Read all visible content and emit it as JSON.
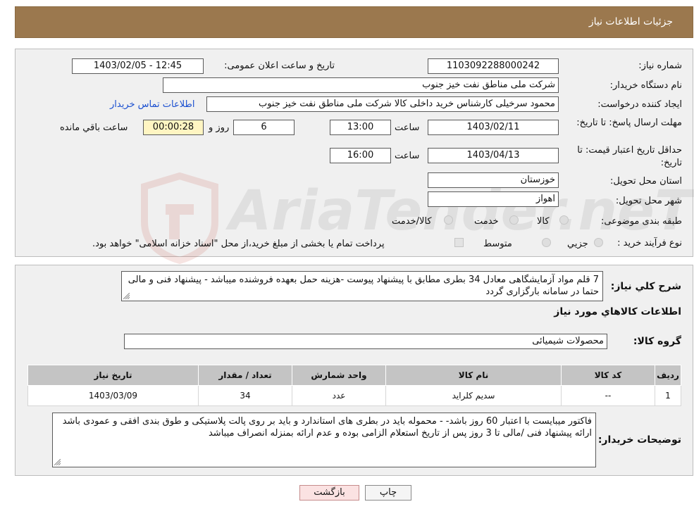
{
  "header": {
    "title": "جزئیات اطلاعات نیاز"
  },
  "form": {
    "need_number_label": "شماره نیاز:",
    "need_number": "1103092288000242",
    "announce_label": "تاریخ و ساعت اعلان عمومی:",
    "announce_value": "1403/02/05 - 12:45",
    "buyer_org_label": "نام دستگاه خریدار:",
    "buyer_org": "شرکت ملی مناطق نفت خیز جنوب",
    "creator_label": "ایجاد کننده درخواست:",
    "creator": "محمود سرخیلی کارشناس خرید داخلی کالا شرکت ملی مناطق نفت خیز جنوب",
    "contact_link": "اطلاعات تماس خریدار",
    "deadline_label": "مهلت ارسال پاسخ: تا تاریخ:",
    "deadline_date": "1403/02/11",
    "time_label": "ساعت",
    "deadline_time": "13:00",
    "days_value": "6",
    "days_label": "روز و",
    "remaining_time": "00:00:28",
    "remaining_label": "ساعت باقي مانده",
    "validity_label": "حداقل تاریخ اعتبار قیمت: تا تاریخ:",
    "validity_date": "1403/04/13",
    "validity_time": "16:00",
    "province_label": "استان محل تحویل:",
    "province": "خوزستان",
    "city_label": "شهر محل تحویل:",
    "city": "اهواز",
    "category_label": "طبقه بندی موضوعی:",
    "category_options": [
      "کالا",
      "خدمت",
      "کالا/خدمت"
    ],
    "process_label": "نوع فرآیند خرید :",
    "process_options": [
      "جزیي",
      "متوسط"
    ],
    "payment_note": "پرداخت تمام یا بخشی از مبلغ خرید،از محل \"اسناد خزانه اسلامی\" خواهد بود."
  },
  "details": {
    "description_label": "شرح کلي نياز:",
    "description": "7 قلم مواد آزمایشگاهی معادل 34 بطری مطابق با پیشنهاد پیوست -هزینه حمل بعهده فروشنده میباشد - پیشنهاد فنی و مالی حتما در سامانه بارگزاری گردد",
    "goods_info_title": "اطلاعات کالاهاي مورد نياز",
    "group_label": "گروه کالا:",
    "group_value": "محصولات شیمیائی",
    "table": {
      "columns": [
        "ردیف",
        "کد کالا",
        "نام کالا",
        "واحد شمارش",
        "تعداد / مقدار",
        "تاریخ نیاز"
      ],
      "rows": [
        [
          "1",
          "--",
          "سدیم کلراید",
          "عدد",
          "34",
          "1403/03/09"
        ]
      ]
    },
    "buyer_notes_label": "توضیحات خریدار:",
    "buyer_notes": "فاکتور میبایست با اعتبار 60 روز باشد- - محموله باید در بطری های استاندارد و باید بر روی پالت پلاستیکی و طوق بندی افقی و عمودی باشد ارائه پیشنهاد فنی /مالی تا 3 روز پس از تاریخ استعلام الزامی بوده و عدم ارائه بمنزله انصراف میباشد"
  },
  "buttons": {
    "print": "چاپ",
    "back": "بازگشت"
  },
  "watermark": {
    "text": "AriaTender.neT"
  },
  "colors": {
    "header_bg": "#9b784e",
    "link": "#1a4fd0",
    "panel_bg": "#f0f0f0",
    "table_header": "#c4c4c4"
  }
}
